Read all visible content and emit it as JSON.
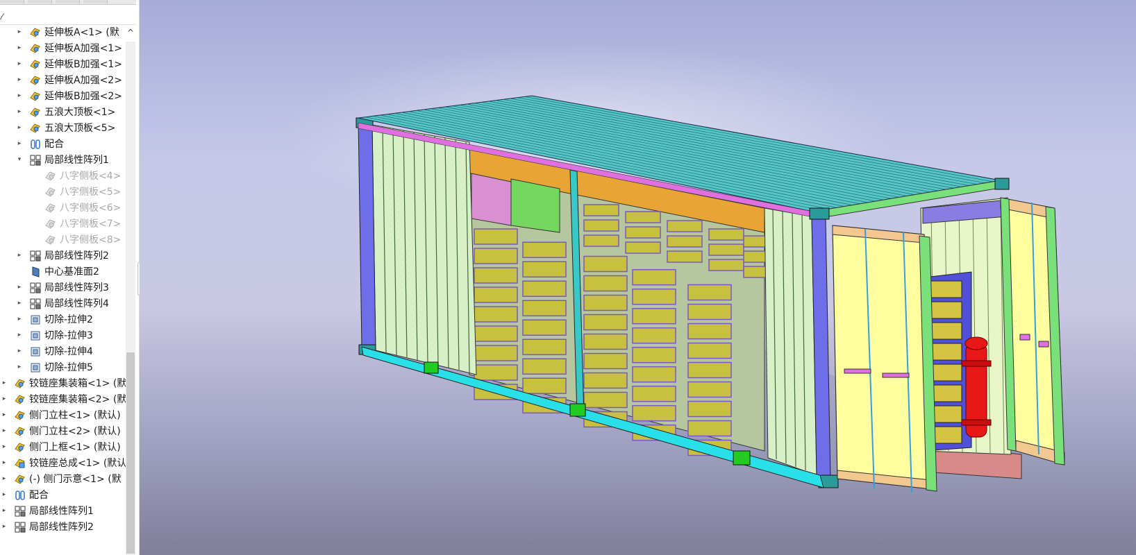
{
  "tree": {
    "items": [
      {
        "label": "延伸板A<1> (默",
        "icon": "part-icon",
        "twisty": "▸",
        "level": 1,
        "suppressed": false
      },
      {
        "label": "延伸板A加强<1>",
        "icon": "part-icon",
        "twisty": "▸",
        "level": 1,
        "suppressed": false
      },
      {
        "label": "延伸板B加强<1>",
        "icon": "part-icon",
        "twisty": "▸",
        "level": 1,
        "suppressed": false
      },
      {
        "label": "延伸板A加强<2>",
        "icon": "part-icon",
        "twisty": "▸",
        "level": 1,
        "suppressed": false
      },
      {
        "label": "延伸板B加强<2>",
        "icon": "part-icon",
        "twisty": "▸",
        "level": 1,
        "suppressed": false
      },
      {
        "label": "五浪大顶板<1>",
        "icon": "part-icon",
        "twisty": "▸",
        "level": 1,
        "suppressed": false
      },
      {
        "label": "五浪大顶板<5>",
        "icon": "part-icon",
        "twisty": "▸",
        "level": 1,
        "suppressed": false
      },
      {
        "label": "配合",
        "icon": "mates-icon",
        "twisty": "▸",
        "level": 1,
        "suppressed": false
      },
      {
        "label": "局部线性阵列1",
        "icon": "pattern-icon",
        "twisty": "▾",
        "level": 1,
        "suppressed": false
      },
      {
        "label": "八字侧板<4>",
        "icon": "suppressed-part-icon",
        "twisty": "",
        "level": 2,
        "suppressed": true
      },
      {
        "label": "八字侧板<5>",
        "icon": "suppressed-part-icon",
        "twisty": "",
        "level": 2,
        "suppressed": true
      },
      {
        "label": "八字侧板<6>",
        "icon": "suppressed-part-icon",
        "twisty": "",
        "level": 2,
        "suppressed": true
      },
      {
        "label": "八字侧板<7>",
        "icon": "suppressed-part-icon",
        "twisty": "",
        "level": 2,
        "suppressed": true
      },
      {
        "label": "八字侧板<8>",
        "icon": "suppressed-part-icon",
        "twisty": "",
        "level": 2,
        "suppressed": true
      },
      {
        "label": "局部线性阵列2",
        "icon": "pattern-icon",
        "twisty": "▸",
        "level": 1,
        "suppressed": false
      },
      {
        "label": "中心基准面2",
        "icon": "plane-icon",
        "twisty": "",
        "level": 1,
        "suppressed": false
      },
      {
        "label": "局部线性阵列3",
        "icon": "pattern-icon",
        "twisty": "▸",
        "level": 1,
        "suppressed": false
      },
      {
        "label": "局部线性阵列4",
        "icon": "pattern-icon",
        "twisty": "▸",
        "level": 1,
        "suppressed": false
      },
      {
        "label": "切除-拉伸2",
        "icon": "cut-extrude-icon",
        "twisty": "▸",
        "level": 1,
        "suppressed": false
      },
      {
        "label": "切除-拉伸3",
        "icon": "cut-extrude-icon",
        "twisty": "▸",
        "level": 1,
        "suppressed": false
      },
      {
        "label": "切除-拉伸4",
        "icon": "cut-extrude-icon",
        "twisty": "▸",
        "level": 1,
        "suppressed": false
      },
      {
        "label": "切除-拉伸5",
        "icon": "cut-extrude-icon",
        "twisty": "▸",
        "level": 1,
        "suppressed": false
      },
      {
        "label": "铰链座集装箱<1> (默",
        "icon": "part-icon",
        "twisty": "▸",
        "level": 0,
        "suppressed": false
      },
      {
        "label": "铰链座集装箱<2> (默",
        "icon": "part-icon",
        "twisty": "▸",
        "level": 0,
        "suppressed": false
      },
      {
        "label": "侧门立柱<1> (默认)",
        "icon": "part-icon",
        "twisty": "▸",
        "level": 0,
        "suppressed": false
      },
      {
        "label": "侧门立柱<2> (默认)",
        "icon": "part-icon",
        "twisty": "▸",
        "level": 0,
        "suppressed": false
      },
      {
        "label": "侧门上框<1> (默认)",
        "icon": "part-icon",
        "twisty": "▸",
        "level": 0,
        "suppressed": false
      },
      {
        "label": "铰链座总成<1> (默认",
        "icon": "assembly-icon",
        "twisty": "▸",
        "level": 0,
        "suppressed": false
      },
      {
        "label": "(-) 侧门示意<1> (默",
        "icon": "part-icon",
        "twisty": "▸",
        "level": 0,
        "suppressed": false
      },
      {
        "label": "配合",
        "icon": "mates-icon",
        "twisty": "▸",
        "level": 0,
        "suppressed": false
      },
      {
        "label": "局部线性阵列1",
        "icon": "pattern-icon",
        "twisty": "▸",
        "level": 0,
        "suppressed": false
      },
      {
        "label": "局部线性阵列2",
        "icon": "pattern-icon",
        "twisty": "▸",
        "level": 0,
        "suppressed": false
      }
    ],
    "filter_mark": "⁄",
    "collapse_caret": "^",
    "splitter_glyph": "◦"
  },
  "viewport": {
    "model": "container-assembly",
    "colors": {
      "roof": "#57c6c7",
      "side_panels": "#d8f0c8",
      "door_leaf": "#ffffa0",
      "base_rail": "#2ae0e8",
      "corner_post": "#6e6ee8",
      "battery": "#c8c040",
      "extinguisher": "#e81818",
      "top_rail": "#e070e0"
    }
  },
  "colors": {
    "viewport_top": "#a6acd8",
    "viewport_bottom": "#7f7f9b",
    "suppressed_text": "#a8a8a8"
  }
}
